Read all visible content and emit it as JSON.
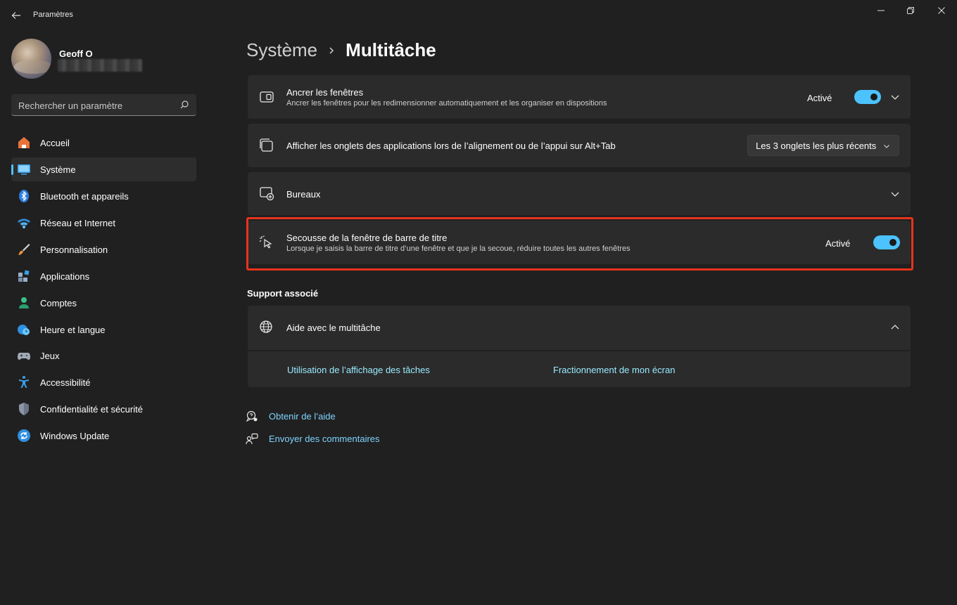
{
  "window": {
    "title": "Paramètres"
  },
  "profile": {
    "name": "Geoff O"
  },
  "search": {
    "placeholder": "Rechercher un paramètre"
  },
  "sidebar": {
    "items": [
      {
        "label": "Accueil",
        "icon": "home-icon"
      },
      {
        "label": "Système",
        "icon": "system-icon",
        "active": true
      },
      {
        "label": "Bluetooth et appareils",
        "icon": "bluetooth-icon"
      },
      {
        "label": "Réseau et Internet",
        "icon": "wifi-icon"
      },
      {
        "label": "Personnalisation",
        "icon": "brush-icon"
      },
      {
        "label": "Applications",
        "icon": "apps-icon"
      },
      {
        "label": "Comptes",
        "icon": "account-icon"
      },
      {
        "label": "Heure et langue",
        "icon": "clock-globe-icon"
      },
      {
        "label": "Jeux",
        "icon": "gamepad-icon"
      },
      {
        "label": "Accessibilité",
        "icon": "accessibility-icon"
      },
      {
        "label": "Confidentialité et sécurité",
        "icon": "shield-icon"
      },
      {
        "label": "Windows Update",
        "icon": "update-icon"
      }
    ]
  },
  "header": {
    "parent": "Système",
    "current": "Multitâche"
  },
  "settings": {
    "snap": {
      "title": "Ancrer les fenêtres",
      "description": "Ancrer les fenêtres pour les redimensionner automatiquement et les organiser en dispositions",
      "state": "Activé",
      "on": true
    },
    "tabs": {
      "title": "Afficher les onglets des applications lors de l’alignement ou de l’appui sur Alt+Tab",
      "selected": "Les 3 onglets les plus récents"
    },
    "desktops": {
      "title": "Bureaux"
    },
    "shake": {
      "title": "Secousse de la fenêtre de barre de titre",
      "description": "Lorsque je saisis la barre de titre d’une fenêtre et que je la secoue, réduire toutes les autres fenêtres",
      "state": "Activé",
      "on": true
    }
  },
  "support": {
    "section_title": "Support associé",
    "help_title": "Aide avec le multitâche",
    "links": [
      "Utilisation de l’affichage des tâches",
      "Fractionnement de mon écran"
    ]
  },
  "footer": {
    "get_help": "Obtenir de l’aide",
    "feedback": "Envoyer des commentaires"
  },
  "colors": {
    "accent": "#4cc2ff",
    "highlight": "#e8331c",
    "background": "#202020",
    "card": "#2b2b2b"
  }
}
